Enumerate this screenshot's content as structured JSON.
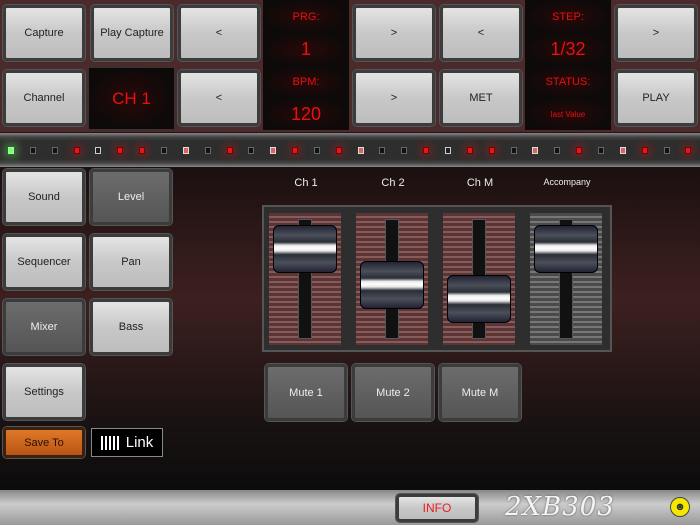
{
  "top": {
    "capture": "Capture",
    "play_capture": "Play Capture",
    "prev1": "<",
    "prg_label": "PRG:",
    "prg_value": "1",
    "next1": ">",
    "prev2": "<",
    "step_label": "STEP:",
    "step_value": "1/32",
    "next2": ">",
    "channel": "Channel",
    "channel_display": "CH 1",
    "prev3": "<",
    "bpm_label": "BPM:",
    "bpm_value": "120",
    "next3": ">",
    "met": "MET",
    "status_label": "STATUS:",
    "status_value": "last Value",
    "play": "PLAY"
  },
  "leds": [
    "green",
    "off",
    "off",
    "red",
    "white",
    "red",
    "red",
    "off",
    "pink",
    "off",
    "red",
    "off",
    "pink",
    "red",
    "off",
    "red",
    "pink",
    "off",
    "off",
    "red",
    "white",
    "red",
    "red",
    "off",
    "pink",
    "off",
    "red",
    "off",
    "pink",
    "red",
    "off",
    "red"
  ],
  "left": {
    "sound": "Sound",
    "level": "Level",
    "sequencer": "Sequencer",
    "pan": "Pan",
    "mixer": "Mixer",
    "bass": "Bass",
    "settings": "Settings",
    "save_to": "Save To",
    "link": "Link"
  },
  "mixer": {
    "channels": [
      {
        "label": "Ch 1",
        "level": 0.95
      },
      {
        "label": "Ch 2",
        "level": 0.5
      },
      {
        "label": "Ch M",
        "level": 0.33
      },
      {
        "label": "Accompany",
        "level": 0.95
      }
    ],
    "mute": [
      "Mute 1",
      "Mute 2",
      "Mute M"
    ]
  },
  "bottom": {
    "info": "INFO",
    "logo": "2XB303"
  }
}
